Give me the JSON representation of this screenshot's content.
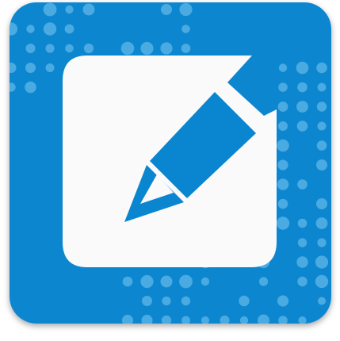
{
  "app_icon": {
    "icon_name": "edit-note-icon",
    "colors": {
      "tile_background": "#0A86D0",
      "dot_pattern": "#5FB5E8",
      "note_paper": "#FAFAFA",
      "pencil": "#0A86D0",
      "pencil_tip": "#FAFAFA",
      "shadow": "#9E9E9E"
    }
  }
}
